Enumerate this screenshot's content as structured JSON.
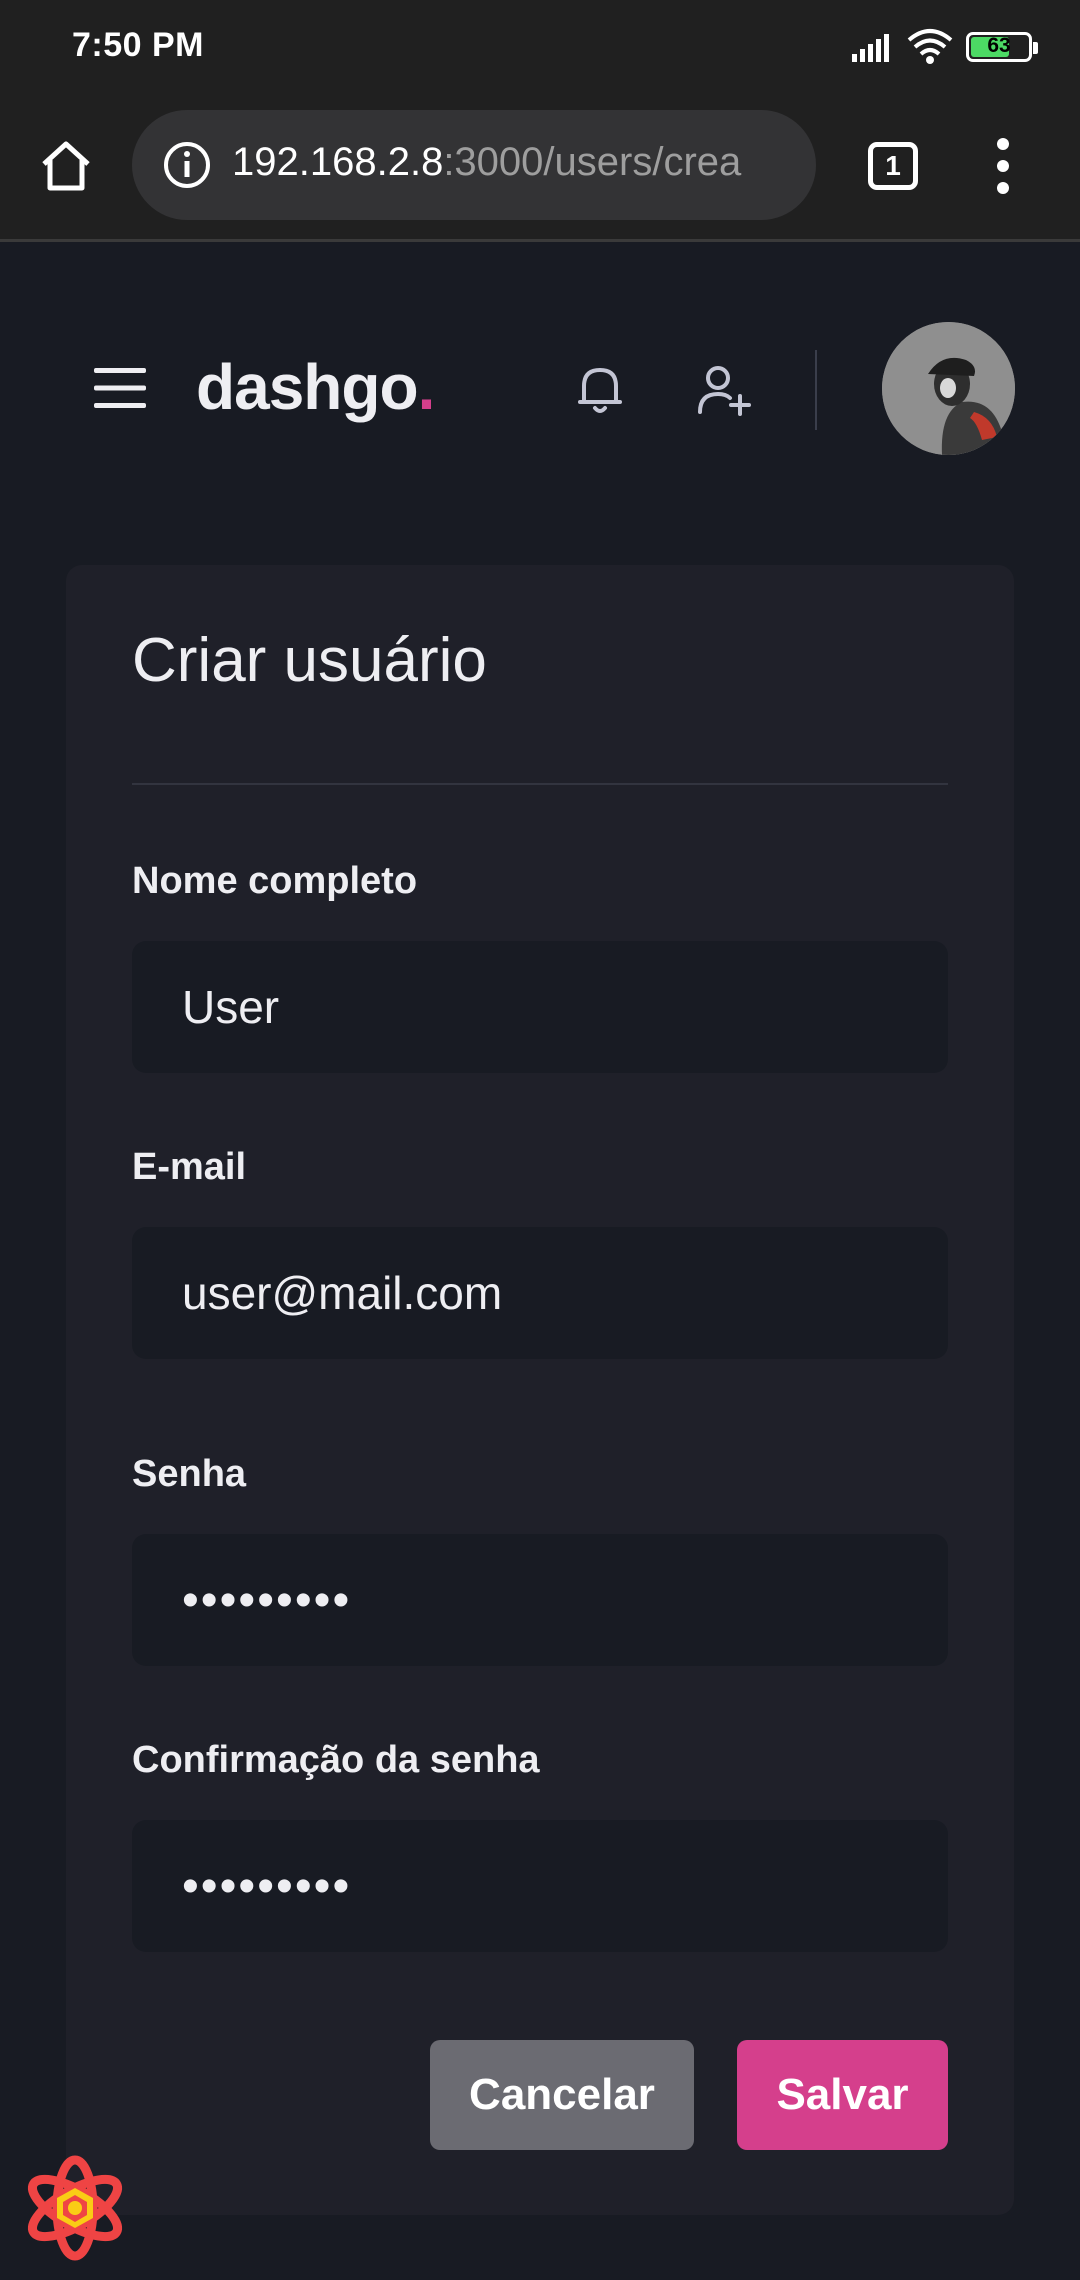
{
  "status_bar": {
    "time": "7:50 PM",
    "battery_level": "63"
  },
  "browser": {
    "url_host": "192.168.2.8",
    "url_path": ":3000/users/crea",
    "tab_count": "1"
  },
  "header": {
    "logo_text": "dashgo",
    "logo_dot": "."
  },
  "form": {
    "title": "Criar usuário",
    "fields": [
      {
        "label": "Nome completo",
        "value": "User"
      },
      {
        "label": "E-mail",
        "value": "user@mail.com"
      },
      {
        "label": "Senha",
        "value": "•••••••••"
      },
      {
        "label": "Confirmação da senha",
        "value": "•••••••••"
      }
    ],
    "cancel_label": "Cancelar",
    "save_label": "Salvar"
  },
  "colors": {
    "background": "#181b23",
    "card": "#1f2029",
    "accent_pink": "#d53f8c",
    "cancel_gray": "#6b6b72"
  }
}
